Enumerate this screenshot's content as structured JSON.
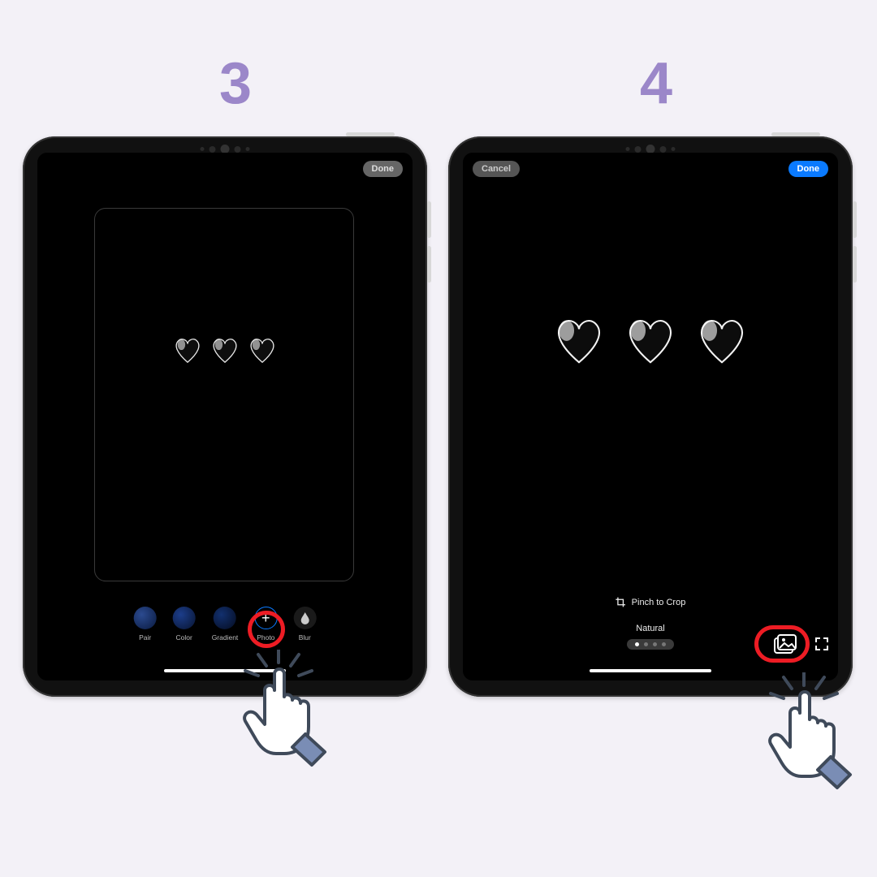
{
  "steps": {
    "three": "3",
    "four": "4"
  },
  "left": {
    "done": "Done",
    "options": {
      "pair": "Pair",
      "color": "Color",
      "gradient": "Gradient",
      "photo": "Photo",
      "blur": "Blur"
    },
    "photo_plus": "+"
  },
  "right": {
    "cancel": "Cancel",
    "done": "Done",
    "pinch": "Pinch to Crop",
    "filter": "Natural"
  },
  "icons": {
    "blur_drop": "💧",
    "crop": "crop-icon",
    "gallery": "gallery-icon"
  },
  "colors": {
    "accent_purple": "#9b87c9",
    "highlight_red": "#ed1c24",
    "ios_blue": "#0a7aff"
  }
}
